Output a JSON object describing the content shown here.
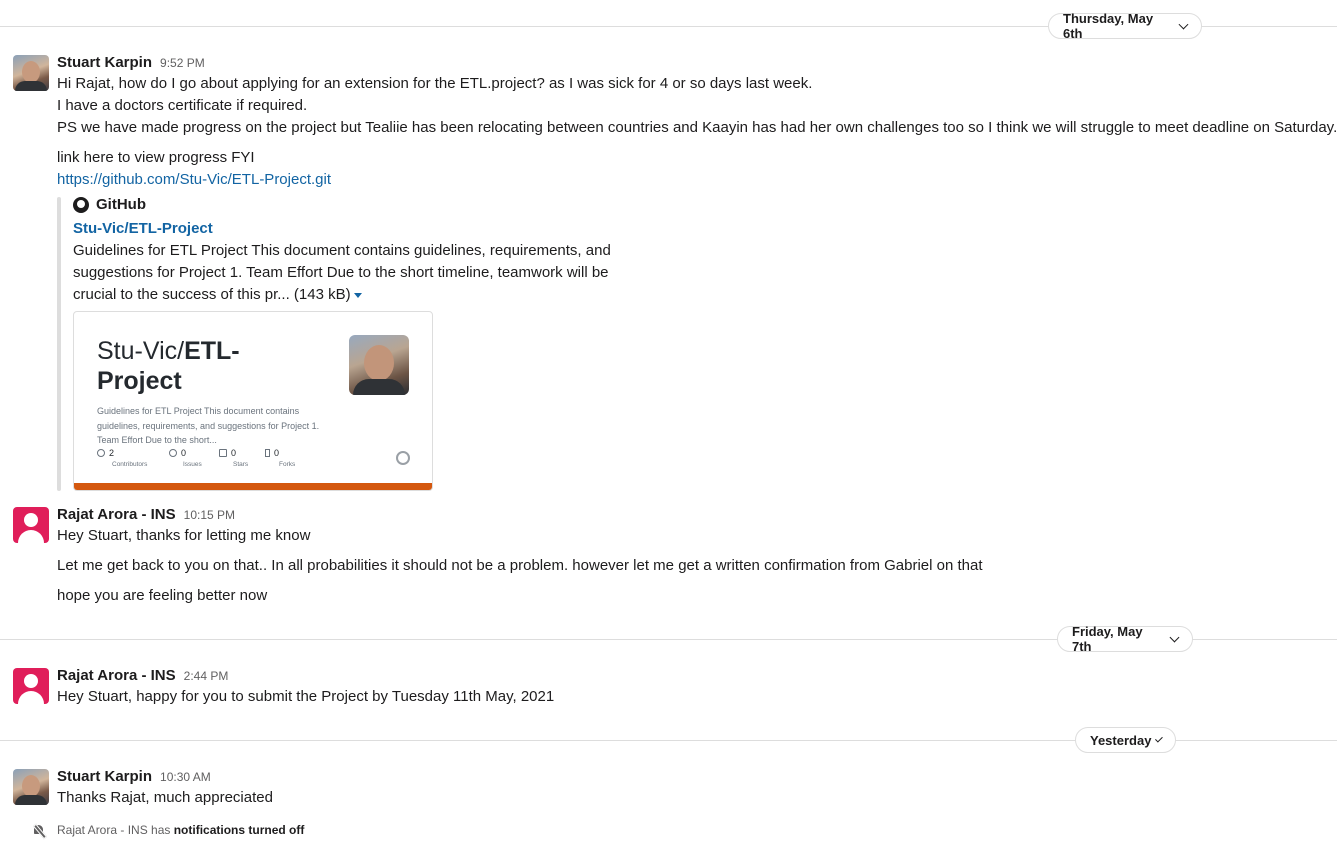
{
  "dates": {
    "first": "Thursday, May 6th",
    "second": "Friday, May 7th",
    "third": "Yesterday"
  },
  "messages": [
    {
      "author": "Stuart Karpin",
      "time": "9:52 PM",
      "lines": [
        "Hi Rajat, how do I go about applying for an extension for the ETL.project? as I was sick for 4 or so days last week.",
        "I have a doctors certificate if required.",
        "PS we have made progress on the project but Tealiie has been relocating between countries and Kaayin has had her own challenges too so I think we will struggle to meet deadline on Saturday.",
        "link here to view progress FYI"
      ],
      "link": "https://github.com/Stu-Vic/ETL-Project.git"
    },
    {
      "author": "Rajat Arora - INS",
      "time": "10:15 PM",
      "lines": [
        "Hey Stuart, thanks for letting me know",
        "Let me get back to you on that.. In all probabilities it should not be a problem. however let me get a written confirmation from Gabriel on that",
        "hope you are feeling better now"
      ]
    },
    {
      "author": "Rajat Arora - INS",
      "time": "2:44 PM",
      "lines": [
        "Hey Stuart, happy for you to submit the Project by Tuesday 11th May, 2021"
      ]
    },
    {
      "author": "Stuart Karpin",
      "time": "10:30 AM",
      "lines": [
        "Thanks Rajat, much appreciated"
      ]
    }
  ],
  "unfurl": {
    "source": "GitHub",
    "title": "Stu-Vic/ETL-Project",
    "desc_lines": [
      "Guidelines for ETL Project This document contains guidelines, requirements, and",
      "suggestions for Project 1. Team Effort Due to the short timeline, teamwork will be",
      "crucial to the success of this pr... (143 kB)"
    ],
    "card": {
      "title_prefix": "Stu-Vic/",
      "title_bold_1": "ETL-",
      "title_bold_2": "Project",
      "desc": "Guidelines for ETL Project This document contains guidelines, requirements, and suggestions for Project 1. Team Effort Due to the short...",
      "stats": [
        {
          "value": "2",
          "label": "Contributors",
          "icon": "people-icon"
        },
        {
          "value": "0",
          "label": "Issues",
          "icon": "issue-icon"
        },
        {
          "value": "0",
          "label": "Stars",
          "icon": "star-icon"
        },
        {
          "value": "0",
          "label": "Forks",
          "icon": "fork-icon"
        }
      ],
      "accent": "#d4580f"
    }
  },
  "notice": {
    "prefix": "Rajat Arora - INS has ",
    "bold": "notifications turned off"
  }
}
